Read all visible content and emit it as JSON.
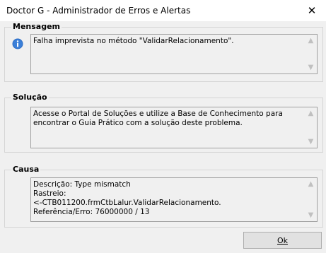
{
  "window": {
    "title": "Doctor G - Administrador de Erros e Alertas",
    "close_glyph": "✕"
  },
  "mensagem": {
    "label": "Mensagem",
    "icon": "info-icon",
    "text": "Falha imprevista no método \"ValidarRelacionamento\"."
  },
  "solucao": {
    "label": "Solução",
    "text": "Acesse o Portal de Soluções e utilize a Base de Conhecimento para encontrar o Guia Prático com a solução deste problema."
  },
  "causa": {
    "label": "Causa",
    "text": "Descrição: Type mismatch\nRastreio:\n<-CTB011200.frmCtbLalur.ValidarRelacionamento.\nReferência/Erro: 76000000 / 13"
  },
  "buttons": {
    "ok_label": "Ok"
  },
  "colors": {
    "info_icon": "#2b6cc4",
    "window_bg": "#f0f0f0"
  }
}
